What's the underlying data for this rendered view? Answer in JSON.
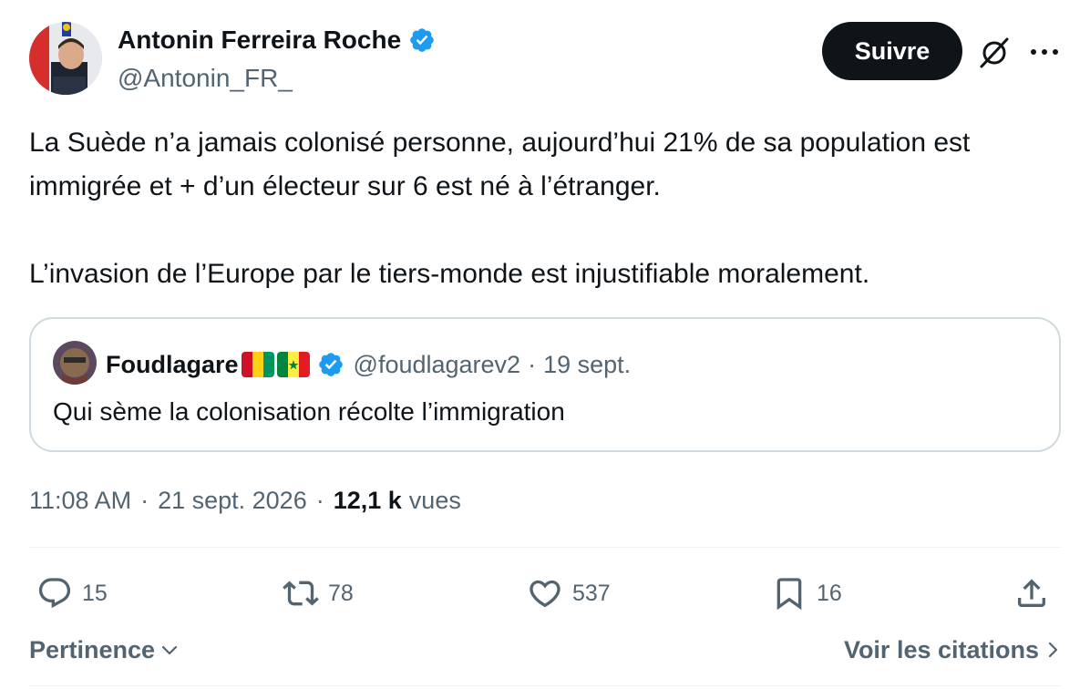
{
  "author": {
    "name": "Antonin Ferreira Roche",
    "handle": "@Antonin_FR_",
    "verified": true
  },
  "follow_label": "Suivre",
  "tweet": {
    "line1": "La Suède n’a jamais colonisé personne, aujourd’hui 21% de sa population est immigrée et + d’un électeur sur 6 est né à l’étranger.",
    "line2": "L’invasion de l’Europe par le tiers-monde est injustifiable moralement."
  },
  "quote": {
    "name": "Foudlagare",
    "handle": "@foudlagarev2",
    "separator": "·",
    "date": "19 sept.",
    "text": "Qui sème la colonisation récolte l’immigration"
  },
  "meta": {
    "time": "11:08 AM",
    "separator": "·",
    "date": "21 sept. 2026",
    "views_count": "12,1 k",
    "views_label": "vues"
  },
  "actions": {
    "replies": "15",
    "reposts": "78",
    "likes": "537",
    "bookmarks": "16"
  },
  "footer": {
    "sort_label": "Pertinence",
    "quotes_link": "Voir les citations"
  },
  "colors": {
    "text_primary": "#0f1419",
    "text_secondary": "#536471",
    "verified_blue": "#1d9bf0",
    "border": "#cfd9de"
  }
}
